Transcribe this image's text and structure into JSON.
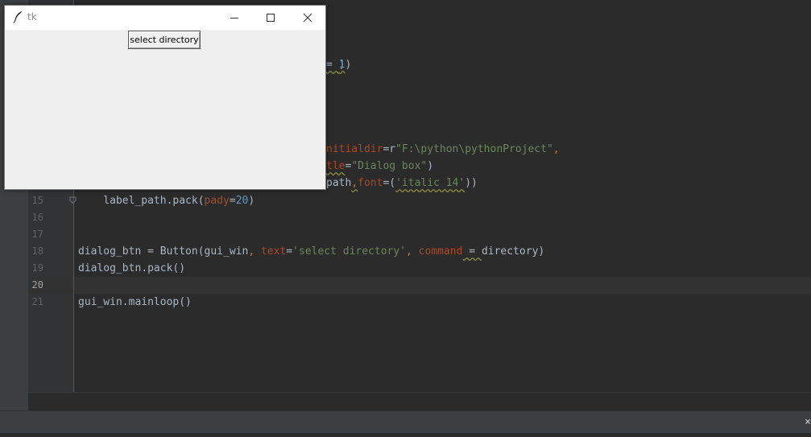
{
  "tk_window": {
    "title": "tk",
    "button_label": "select directory"
  },
  "editor": {
    "line_numbers": {
      "l15": "15",
      "l16": "16",
      "l17": "17",
      "l18": "18",
      "l19": "19",
      "l20": "20",
      "l21": "21"
    },
    "partial_lines": {
      "p1_close": ")",
      "p2_eq": "= ",
      "p2_num": "1",
      "p2_close": ")",
      "p3_param": "nitialdir",
      "p3_eq": "=r",
      "p3_str": "\"F:\\python\\pythonProject\"",
      "p3_comma": ",",
      "p4_param": "tle",
      "p4_eq": "=",
      "p4_str": "\"Dialog box\"",
      "p4_close": ")",
      "p5_a": "path",
      "p5_comma": ",",
      "p5_param": "font",
      "p5_eq": "=(",
      "p5_str": "'italic 14'",
      "p5_close": "))"
    },
    "line15": {
      "a": "    label_path.pack(",
      "param": "pady",
      "eq": "=",
      "num": "20",
      "close": ")"
    },
    "line18": {
      "a": "dialog_btn = Button(gui_win",
      "comma1": ", ",
      "param1": "text",
      "eq1": "=",
      "str": "'select directory'",
      "comma2": ", ",
      "param2": "command",
      "eq2": " = ",
      "b": "directory)"
    },
    "line19": "dialog_btn.pack()",
    "line21": "gui_win.mainloop()"
  },
  "status_bar": {
    "close_glyph": "×"
  }
}
